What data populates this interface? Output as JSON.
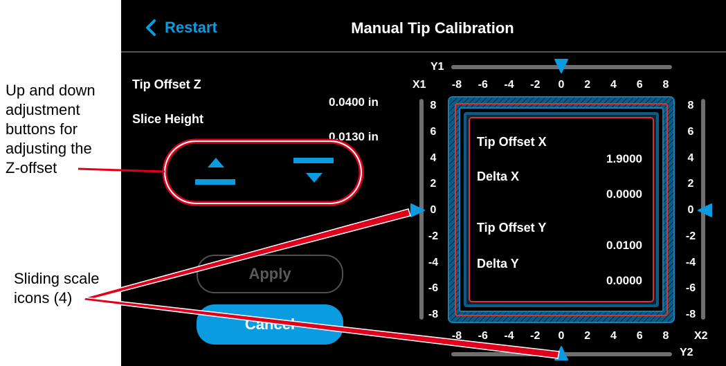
{
  "header": {
    "back_label": "Restart",
    "title": "Manual Tip Calibration"
  },
  "left_panel": {
    "tip_offset_z_label": "Tip Offset Z",
    "tip_offset_z_value": "0.0400 in",
    "slice_height_label": "Slice Height",
    "slice_height_value": "0.0130 in",
    "apply_label": "Apply",
    "cancel_label": "Cancel"
  },
  "scales": {
    "y1_label": "Y1",
    "y2_label": "Y2",
    "x1_label": "X1",
    "x2_label": "X2",
    "horizontal_ticks": [
      "-8",
      "-6",
      "-4",
      "-2",
      "0",
      "2",
      "4",
      "6",
      "8"
    ],
    "vertical_ticks": [
      "8",
      "6",
      "4",
      "2",
      "0",
      "-2",
      "-4",
      "-6",
      "-8"
    ],
    "y1_value": 0,
    "y2_value": 0,
    "x1_value": 0,
    "x2_value": 0
  },
  "readout": {
    "tip_offset_x_label": "Tip Offset X",
    "tip_offset_x_value": "1.9000",
    "delta_x_label": "Delta X",
    "delta_x_value": "0.0000",
    "tip_offset_y_label": "Tip Offset Y",
    "tip_offset_y_value": "0.0100",
    "delta_y_label": "Delta Y",
    "delta_y_value": "0.0000"
  },
  "annotations": {
    "adjust_buttons_callout": [
      "Up and down",
      "adjustment",
      "buttons for",
      "adjusting the",
      "Z-offset"
    ],
    "sliding_scale_callout": [
      "Sliding scale",
      "icons (4)"
    ]
  },
  "colors": {
    "accent": "#0a9be0",
    "callout_red": "#e0001b",
    "inner_frame_red": "#e03030",
    "panel_blue": "#0d5c86"
  }
}
